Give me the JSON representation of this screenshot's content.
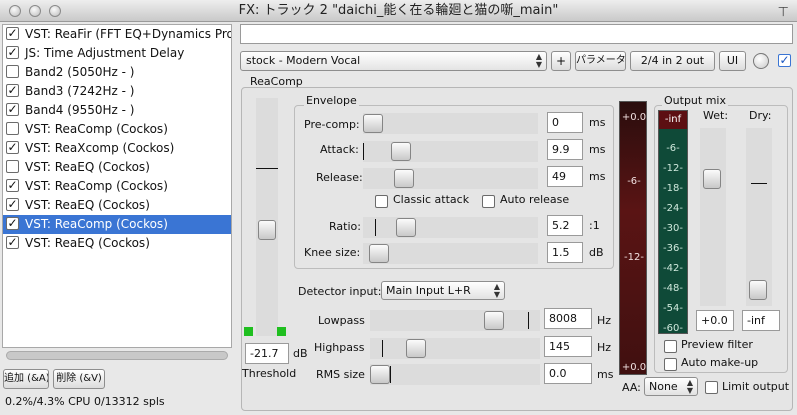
{
  "window": {
    "title": "FX: トラック 2 \"daichi_能く在る輪廻と猫の噺_main\""
  },
  "fx_list": [
    {
      "label": "VST: ReaFir (FFT EQ+Dynamics Proc",
      "checked": true,
      "selected": false
    },
    {
      "label": "JS: Time Adjustment Delay",
      "checked": true,
      "selected": false
    },
    {
      "label": "Band2 (5050Hz - )",
      "checked": false,
      "selected": false
    },
    {
      "label": "Band3 (7242Hz - )",
      "checked": true,
      "selected": false
    },
    {
      "label": "Band4 (9550Hz - )",
      "checked": true,
      "selected": false
    },
    {
      "label": "VST: ReaComp (Cockos)",
      "checked": false,
      "selected": false
    },
    {
      "label": "VST: ReaXcomp (Cockos)",
      "checked": true,
      "selected": false
    },
    {
      "label": "VST: ReaEQ (Cockos)",
      "checked": false,
      "selected": false
    },
    {
      "label": "VST: ReaComp (Cockos)",
      "checked": true,
      "selected": false
    },
    {
      "label": "VST: ReaEQ (Cockos)",
      "checked": true,
      "selected": false
    },
    {
      "label": "VST: ReaComp (Cockos)",
      "checked": true,
      "selected": true
    },
    {
      "label": "VST: ReaEQ (Cockos)",
      "checked": true,
      "selected": false
    }
  ],
  "footer": {
    "add_label": "追加 (&A)",
    "remove_label": "削除 (&V)",
    "cpu_text": "0.2%/4.3% CPU 0/13312 spls"
  },
  "header": {
    "preset": "stock - Modern Vocal",
    "plus_label": "+",
    "params_label": "パラメータ",
    "io_label": "2/4 in 2 out",
    "ui_label": "UI"
  },
  "plugin": {
    "name": "ReaComp",
    "envelope_label": "Envelope",
    "threshold": {
      "label": "Threshold",
      "value": "-21.7",
      "unit": "dB",
      "level": 0.44
    },
    "precomp": {
      "label": "Pre-comp:",
      "value": "0",
      "unit": "ms",
      "level": 0.0
    },
    "attack": {
      "label": "Attack:",
      "value": "9.9",
      "unit": "ms",
      "level": 0.18
    },
    "release": {
      "label": "Release:",
      "value": "49",
      "unit": "ms",
      "level": 0.2
    },
    "classic_attack": {
      "label": "Classic attack",
      "checked": false
    },
    "auto_release": {
      "label": "Auto release",
      "checked": false
    },
    "ratio": {
      "label": "Ratio:",
      "value": "5.2",
      "unit": ":1",
      "level": 0.21
    },
    "knee": {
      "label": "Knee size:",
      "value": "1.5",
      "unit": "dB",
      "level": 0.04
    },
    "detector": {
      "label": "Detector input:",
      "value": "Main Input L+R"
    },
    "lowpass": {
      "label": "Lowpass",
      "value": "8008",
      "unit": "Hz",
      "level": 0.76
    },
    "highpass": {
      "label": "Highpass",
      "value": "145",
      "unit": "Hz",
      "level": 0.24
    },
    "rms": {
      "label": "RMS size",
      "value": "0.0",
      "unit": "ms",
      "level": 0.0
    },
    "meter": {
      "top": "+0.0",
      "mid1": "-6-",
      "mid2": "-12-",
      "bottom": "+0.0"
    },
    "output_mix": {
      "label": "Output mix",
      "top_readout": "-inf",
      "scale": [
        "-6-",
        "-12-",
        "-18-",
        "-24-",
        "-30-",
        "-36-",
        "-42-",
        "-48-",
        "-54-",
        "-60-"
      ],
      "wet_label": "Wet:",
      "dry_label": "Dry:",
      "wet_value": "+0.0",
      "dry_value": "-inf",
      "wet_level": 0.74,
      "dry_level": 0.04
    },
    "preview_filter": {
      "label": "Preview filter",
      "checked": false
    },
    "auto_makeup": {
      "label": "Auto make-up",
      "checked": false
    },
    "aa": {
      "label": "AA:",
      "value": "None"
    },
    "limit_output": {
      "label": "Limit output",
      "checked": false
    }
  }
}
